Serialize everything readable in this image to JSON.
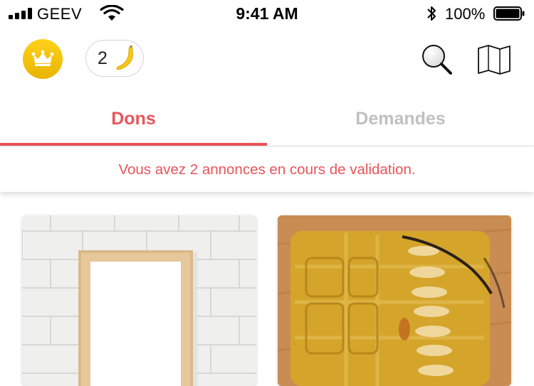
{
  "status_bar": {
    "carrier": "GEEV",
    "time": "9:41 AM",
    "battery_percent": "100%",
    "icons": [
      "signal-icon",
      "wifi-icon",
      "bluetooth-icon",
      "battery-icon"
    ]
  },
  "header": {
    "premium_icon": "crown-icon",
    "banana_count": "2",
    "banana_icon": "banana-icon",
    "actions": [
      "search-icon",
      "map-icon"
    ]
  },
  "tabs": [
    {
      "label": "Dons",
      "active": true
    },
    {
      "label": "Demandes",
      "active": false
    }
  ],
  "notice": "Vous avez 2 annonces en cours de validation.",
  "colors": {
    "accent": "#e8555a",
    "inactive_tab": "#c0c0c0",
    "premium_gold": "#f2c40c"
  },
  "listings": [
    {
      "image": "white-picture-frame-on-brick-wall"
    },
    {
      "image": "yellow-document-folder-on-wood"
    }
  ]
}
